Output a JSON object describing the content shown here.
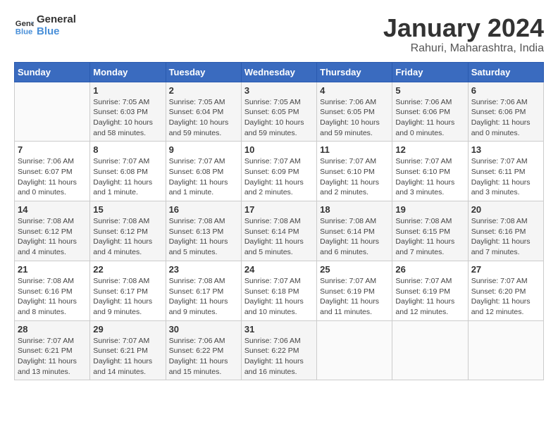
{
  "header": {
    "logo_line1": "General",
    "logo_line2": "Blue",
    "month": "January 2024",
    "location": "Rahuri, Maharashtra, India"
  },
  "weekdays": [
    "Sunday",
    "Monday",
    "Tuesday",
    "Wednesday",
    "Thursday",
    "Friday",
    "Saturday"
  ],
  "weeks": [
    [
      {
        "day": "",
        "info": ""
      },
      {
        "day": "1",
        "info": "Sunrise: 7:05 AM\nSunset: 6:03 PM\nDaylight: 10 hours\nand 58 minutes."
      },
      {
        "day": "2",
        "info": "Sunrise: 7:05 AM\nSunset: 6:04 PM\nDaylight: 10 hours\nand 59 minutes."
      },
      {
        "day": "3",
        "info": "Sunrise: 7:05 AM\nSunset: 6:05 PM\nDaylight: 10 hours\nand 59 minutes."
      },
      {
        "day": "4",
        "info": "Sunrise: 7:06 AM\nSunset: 6:05 PM\nDaylight: 10 hours\nand 59 minutes."
      },
      {
        "day": "5",
        "info": "Sunrise: 7:06 AM\nSunset: 6:06 PM\nDaylight: 11 hours\nand 0 minutes."
      },
      {
        "day": "6",
        "info": "Sunrise: 7:06 AM\nSunset: 6:06 PM\nDaylight: 11 hours\nand 0 minutes."
      }
    ],
    [
      {
        "day": "7",
        "info": "Sunrise: 7:06 AM\nSunset: 6:07 PM\nDaylight: 11 hours\nand 0 minutes."
      },
      {
        "day": "8",
        "info": "Sunrise: 7:07 AM\nSunset: 6:08 PM\nDaylight: 11 hours\nand 1 minute."
      },
      {
        "day": "9",
        "info": "Sunrise: 7:07 AM\nSunset: 6:08 PM\nDaylight: 11 hours\nand 1 minute."
      },
      {
        "day": "10",
        "info": "Sunrise: 7:07 AM\nSunset: 6:09 PM\nDaylight: 11 hours\nand 2 minutes."
      },
      {
        "day": "11",
        "info": "Sunrise: 7:07 AM\nSunset: 6:10 PM\nDaylight: 11 hours\nand 2 minutes."
      },
      {
        "day": "12",
        "info": "Sunrise: 7:07 AM\nSunset: 6:10 PM\nDaylight: 11 hours\nand 3 minutes."
      },
      {
        "day": "13",
        "info": "Sunrise: 7:07 AM\nSunset: 6:11 PM\nDaylight: 11 hours\nand 3 minutes."
      }
    ],
    [
      {
        "day": "14",
        "info": "Sunrise: 7:08 AM\nSunset: 6:12 PM\nDaylight: 11 hours\nand 4 minutes."
      },
      {
        "day": "15",
        "info": "Sunrise: 7:08 AM\nSunset: 6:12 PM\nDaylight: 11 hours\nand 4 minutes."
      },
      {
        "day": "16",
        "info": "Sunrise: 7:08 AM\nSunset: 6:13 PM\nDaylight: 11 hours\nand 5 minutes."
      },
      {
        "day": "17",
        "info": "Sunrise: 7:08 AM\nSunset: 6:14 PM\nDaylight: 11 hours\nand 5 minutes."
      },
      {
        "day": "18",
        "info": "Sunrise: 7:08 AM\nSunset: 6:14 PM\nDaylight: 11 hours\nand 6 minutes."
      },
      {
        "day": "19",
        "info": "Sunrise: 7:08 AM\nSunset: 6:15 PM\nDaylight: 11 hours\nand 7 minutes."
      },
      {
        "day": "20",
        "info": "Sunrise: 7:08 AM\nSunset: 6:16 PM\nDaylight: 11 hours\nand 7 minutes."
      }
    ],
    [
      {
        "day": "21",
        "info": "Sunrise: 7:08 AM\nSunset: 6:16 PM\nDaylight: 11 hours\nand 8 minutes."
      },
      {
        "day": "22",
        "info": "Sunrise: 7:08 AM\nSunset: 6:17 PM\nDaylight: 11 hours\nand 9 minutes."
      },
      {
        "day": "23",
        "info": "Sunrise: 7:08 AM\nSunset: 6:17 PM\nDaylight: 11 hours\nand 9 minutes."
      },
      {
        "day": "24",
        "info": "Sunrise: 7:07 AM\nSunset: 6:18 PM\nDaylight: 11 hours\nand 10 minutes."
      },
      {
        "day": "25",
        "info": "Sunrise: 7:07 AM\nSunset: 6:19 PM\nDaylight: 11 hours\nand 11 minutes."
      },
      {
        "day": "26",
        "info": "Sunrise: 7:07 AM\nSunset: 6:19 PM\nDaylight: 11 hours\nand 12 minutes."
      },
      {
        "day": "27",
        "info": "Sunrise: 7:07 AM\nSunset: 6:20 PM\nDaylight: 11 hours\nand 12 minutes."
      }
    ],
    [
      {
        "day": "28",
        "info": "Sunrise: 7:07 AM\nSunset: 6:21 PM\nDaylight: 11 hours\nand 13 minutes."
      },
      {
        "day": "29",
        "info": "Sunrise: 7:07 AM\nSunset: 6:21 PM\nDaylight: 11 hours\nand 14 minutes."
      },
      {
        "day": "30",
        "info": "Sunrise: 7:06 AM\nSunset: 6:22 PM\nDaylight: 11 hours\nand 15 minutes."
      },
      {
        "day": "31",
        "info": "Sunrise: 7:06 AM\nSunset: 6:22 PM\nDaylight: 11 hours\nand 16 minutes."
      },
      {
        "day": "",
        "info": ""
      },
      {
        "day": "",
        "info": ""
      },
      {
        "day": "",
        "info": ""
      }
    ]
  ]
}
